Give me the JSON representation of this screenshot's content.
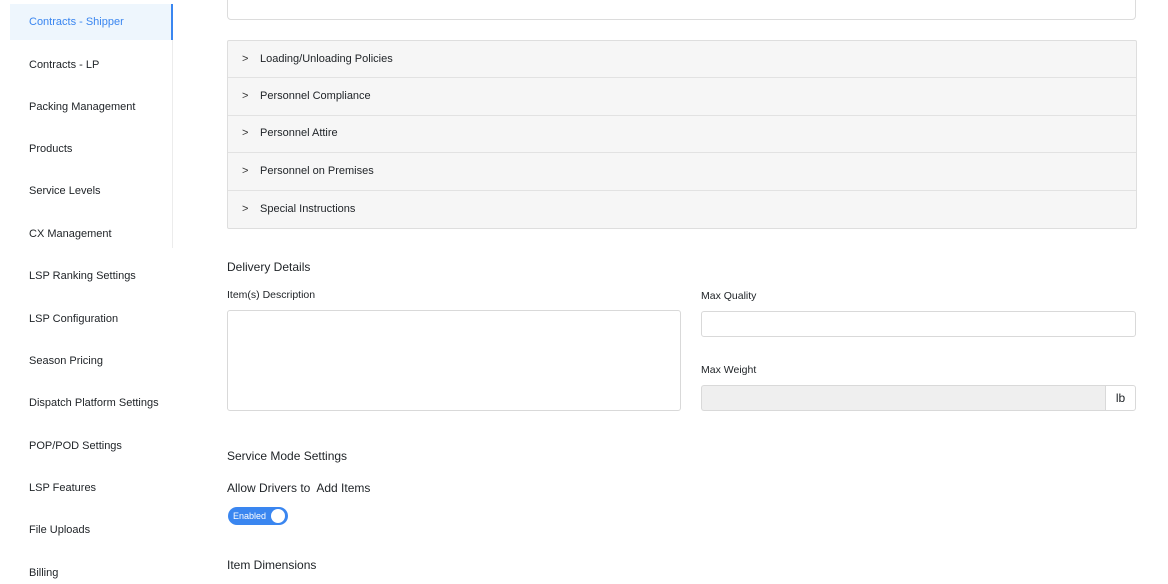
{
  "sidebar": {
    "items": [
      {
        "label": "Contracts - Shipper",
        "active": true
      },
      {
        "label": "Contracts - LP"
      },
      {
        "label": "Packing Management"
      },
      {
        "label": "Products"
      },
      {
        "label": "Service Levels"
      },
      {
        "label": "CX Management"
      },
      {
        "label": "LSP Ranking Settings"
      },
      {
        "label": "LSP Configuration"
      },
      {
        "label": "Season Pricing"
      },
      {
        "label": "Dispatch Platform Settings"
      },
      {
        "label": "POP/POD Settings"
      },
      {
        "label": "LSP Features"
      },
      {
        "label": "File Uploads"
      },
      {
        "label": "Billing"
      }
    ]
  },
  "policies": {
    "chevron": ">",
    "items": [
      "Loading/Unloading Policies",
      "Personnel Compliance",
      "Personnel Attire",
      "Personnel on Premises",
      "Special Instructions"
    ]
  },
  "delivery": {
    "title": "Delivery Details",
    "description_label": "Item(s) Description",
    "description_value": "",
    "max_quality_label": "Max Quality",
    "max_quality_value": "",
    "max_weight_label": "Max Weight",
    "max_weight_value": "",
    "weight_unit": "lb"
  },
  "service_mode": {
    "title": "Service Mode Settings",
    "allow_drivers_label": "Allow Drivers to  Add Items",
    "toggle_label": "Enabled",
    "toggle_on": true
  },
  "item_dimensions": {
    "title": "Item Dimensions"
  },
  "colors": {
    "accent": "#3a86f0",
    "active_bg": "#eef6fd",
    "accordion_bg": "#f6f6f6"
  }
}
